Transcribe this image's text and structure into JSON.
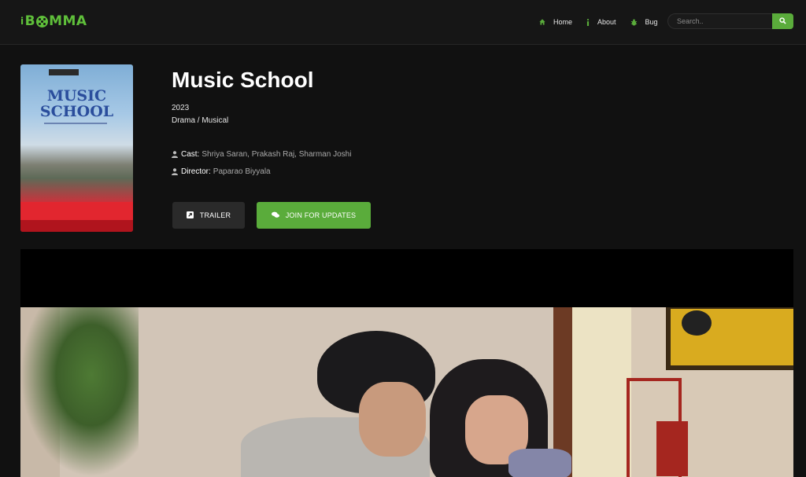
{
  "brand": {
    "logo_text_left": "i",
    "logo_text_b": "B",
    "logo_text_right": "MMA"
  },
  "nav": {
    "items": [
      {
        "label": "Home",
        "icon": "home-icon"
      },
      {
        "label": "About",
        "icon": "info-icon"
      },
      {
        "label": "Bug",
        "icon": "bug-icon"
      }
    ]
  },
  "search": {
    "placeholder": "Search..",
    "value": ""
  },
  "movie": {
    "title": "Music School",
    "year": "2023",
    "genre": "Drama / Musical",
    "cast_label": "Cast:",
    "cast_value": "Shriya Saran, Prakash Raj, Sharman Joshi",
    "director_label": "Director:",
    "director_value": "Paparao Biyyala",
    "poster_title_line1": "MUSIC",
    "poster_title_line2": "SCHOOL"
  },
  "buttons": {
    "trailer": "TRAILER",
    "join": "JOIN FOR UPDATES"
  },
  "colors": {
    "accent": "#5aac3b",
    "background": "#111111",
    "navbar": "#161616"
  }
}
